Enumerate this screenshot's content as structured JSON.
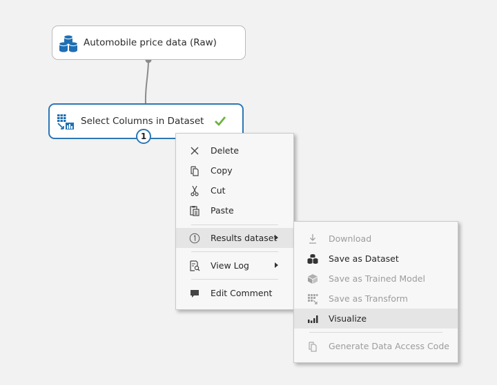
{
  "canvas": {
    "nodes": {
      "raw": {
        "label": "Automobile price data (Raw)",
        "icon": "dataset-icon"
      },
      "select": {
        "label": "Select Columns in Dataset",
        "icon": "select-columns-icon",
        "status": "completed",
        "port_number": "1"
      }
    }
  },
  "context_menu": {
    "items": [
      {
        "label": "Delete",
        "icon": "delete-x-icon"
      },
      {
        "label": "Copy",
        "icon": "copy-icon"
      },
      {
        "label": "Cut",
        "icon": "scissors-icon"
      },
      {
        "label": "Paste",
        "icon": "paste-icon"
      },
      {
        "label": "Results dataset",
        "icon": "port-1-icon",
        "submenu": true,
        "highlighted": true
      },
      {
        "label": "View Log",
        "icon": "view-log-icon",
        "submenu": true
      },
      {
        "label": "Edit Comment",
        "icon": "comment-icon"
      }
    ]
  },
  "submenu": {
    "items": [
      {
        "label": "Download",
        "icon": "download-icon",
        "enabled": false
      },
      {
        "label": "Save as Dataset",
        "icon": "dataset-icon",
        "enabled": true
      },
      {
        "label": "Save as Trained Model",
        "icon": "trained-model-icon",
        "enabled": false
      },
      {
        "label": "Save as Transform",
        "icon": "transform-icon",
        "enabled": false
      },
      {
        "label": "Visualize",
        "icon": "visualize-icon",
        "enabled": true,
        "highlighted": true
      },
      {
        "label": "Generate Data Access Code",
        "icon": "data-access-code-icon",
        "enabled": false
      }
    ]
  },
  "colors": {
    "accent": "#2a76b5",
    "success": "#6cb33f",
    "canvas": "#f2f2f2",
    "menu_bg": "#f7f7f7",
    "menu_highlight": "#e5e5e5"
  }
}
